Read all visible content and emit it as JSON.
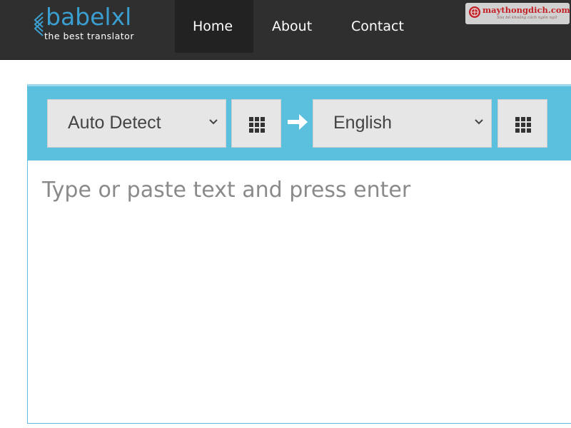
{
  "brand": {
    "name": "babelxl",
    "tagline": "the best translator",
    "accent_color": "#3a9fd0"
  },
  "nav": {
    "items": [
      {
        "label": "Home",
        "active": true
      },
      {
        "label": "About",
        "active": false
      },
      {
        "label": "Contact",
        "active": false
      }
    ]
  },
  "watermark": {
    "site": "maythongdich.com",
    "slogan": "Xóa bỏ khoảng cách ngôn ngữ",
    "color": "#d31f26"
  },
  "translator": {
    "source_language": "Auto Detect",
    "target_language": "English",
    "source_keyboard_icon": "grid-icon",
    "swap_icon": "arrow-right-icon",
    "target_keyboard_icon": "grid-icon",
    "input_placeholder": "Type or paste text and press enter",
    "input_value": "",
    "toolbar_color": "#5bc0de"
  }
}
